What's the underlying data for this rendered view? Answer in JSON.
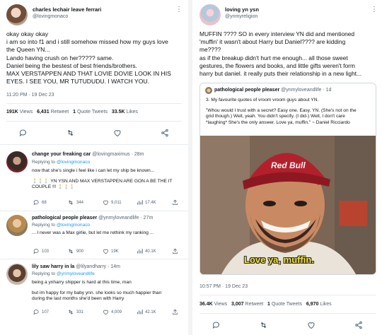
{
  "left": {
    "tweet": {
      "name": "charles lechair leave ferrari",
      "handle": "@lovingmonaco",
      "lines": [
        "okay okay okay",
        "i am so into f1 and i still somehow missed how my guys love",
        "the Queen YN...",
        "Lando having crush on her????? same.",
        "Daniel being the bestest of best friends/brothers.",
        "MAX VERSTAPPEN AND THAT LOVIE DOVIE LOOK IN HIS",
        "EYES. I SEE YOU, MR TUTUDUDU. I WATCH YOU."
      ],
      "time": "11:20 PM · 19 Dec 23",
      "views_num": "191K",
      "views_label": "Views",
      "retweets_num": "6,431",
      "retweets_label": "Retweet",
      "quotes_num": "1",
      "quotes_label": "Quote Tweets",
      "likes_num": "33.5K",
      "likes_label": "Likes"
    },
    "replies": [
      {
        "name": "change your freaking car",
        "handle": "@lovingmaximus · 28m",
        "replying_prefix": "Replying to",
        "replying_to": "@lovingmonaco",
        "lines": [
          "now that she's single i feel like i can let my ship be known...",
          "",
          "🕯️🕯️🕯️ YN YSN AND MAX VERSTAPPEN ARE GON A BE THE IT",
          "COUPLE !!! 🕯️🕯️🕯️"
        ],
        "replies": "68",
        "retweets": "344",
        "likes": "9,011",
        "views": "17.4K"
      },
      {
        "name": "pathological people pleaser",
        "handle": "@ynmyloveandlife · 27m",
        "replying_prefix": "Replying to",
        "replying_to": "@lovingmonaco",
        "lines": [
          "... I never was a Max girlie, but let me rethink my ranking ..."
        ],
        "replies": "103",
        "retweets": "900",
        "likes": "19K",
        "views": "40.1K"
      },
      {
        "name": "lily saw harry in la",
        "handle": "@lilyandharry · 14m",
        "replying_prefix": "Replying to",
        "replying_to": "@ynmyloveandlife",
        "lines": [
          "being a ynharry shipper is hard at this time, man",
          "",
          "but im happy for my baby ynn. she looks so much happier than",
          "during the last months she'd been with Harry"
        ],
        "replies": "107",
        "retweets": "331",
        "likes": "4,009",
        "views": "42.1K"
      }
    ]
  },
  "right": {
    "tweet": {
      "name": "loving yn ysn",
      "handle": "@ynmyreligion",
      "lines": [
        "MUFFIN ???? SO in every interview YN did and mentioned",
        "'muffin' it wasn't about Harry but Daniel???? are kidding",
        "me????",
        "as if the breakup didn't hurt me enough... all those sweet",
        "gestures, the flowers and books, and little gifts weren't form",
        "harry but daniel. it really puts their relationship in a new light..."
      ],
      "time": "10:57 PM · 19 Dec 23",
      "views_num": "36.4K",
      "views_label": "Views",
      "retweets_num": "3,007",
      "retweets_label": "Retweet",
      "quotes_num": "1",
      "quotes_label": "Quote Tweets",
      "likes_num": "6,970",
      "likes_label": "Likes"
    },
    "quote": {
      "name": "pathological people pleaser",
      "handle": "@ynmyloveandlife · 1d",
      "lines": [
        "3. My favourite quotes of vroom vroom guys about YN.",
        "",
        "\"Whou would I trust with a secret? Easy one. Easy. YN. (She's not on the",
        "grid though.) Well, yeah. You didn't specify. (I did-) Well, I don't care",
        "*laughing* She's the only answer. Love ya, muffin.\" ~ Daniel Ricciardo"
      ],
      "caption": "Love ya, muffin."
    }
  },
  "colors": {
    "accent": "#1d9bf0",
    "secondary_text": "#536471",
    "border": "#e6ecf0"
  },
  "icons": [
    "reply-icon",
    "retweet-icon",
    "like-icon",
    "share-icon",
    "views-icon",
    "more-icon"
  ]
}
